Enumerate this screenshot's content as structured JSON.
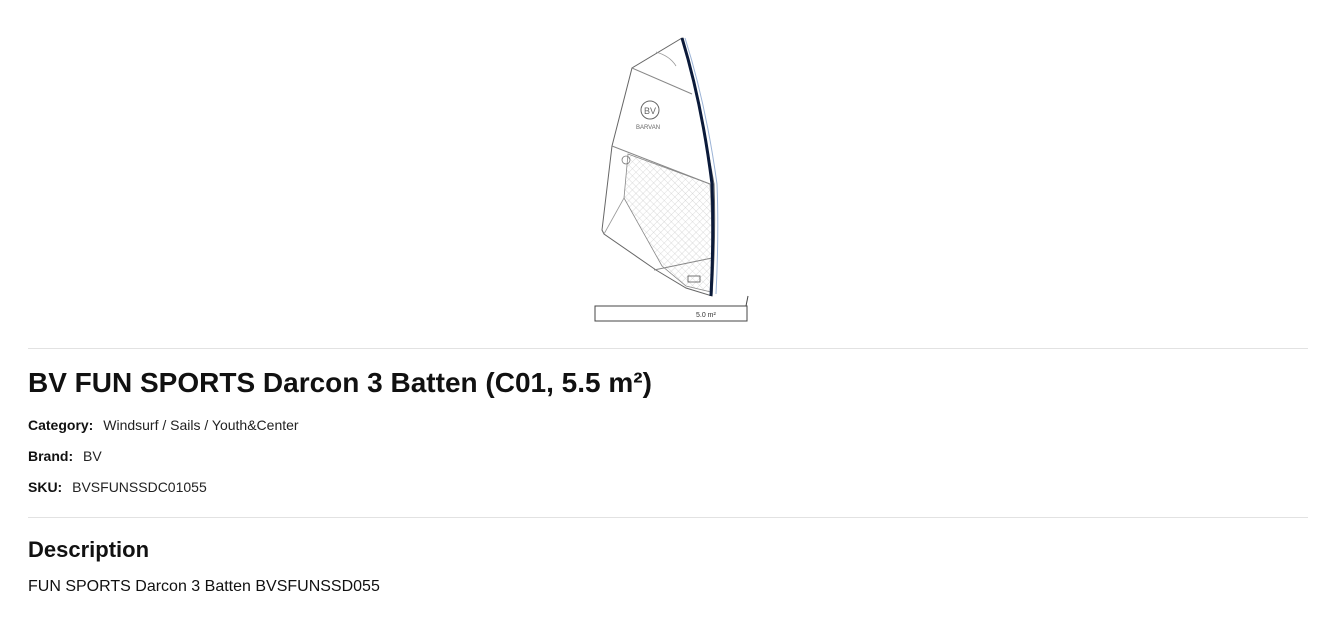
{
  "product": {
    "image_label": "5.0 m²",
    "image_logo_text": "BARVAN",
    "image_logo_mark": "BV",
    "title": "BV FUN SPORTS Darcon 3 Batten (C01, 5.5 m²)",
    "meta": {
      "category_label": "Category:",
      "category_value": "Windsurf / Sails / Youth&Center",
      "brand_label": "Brand:",
      "brand_value": "BV",
      "sku_label": "SKU:",
      "sku_value": "BVSFUNSSDC01055"
    },
    "description": {
      "heading": "Description",
      "text": "FUN SPORTS Darcon 3 Batten BVSFUNSSD055"
    }
  },
  "colors": {
    "mast": "#0b1a3a",
    "outline": "#555555",
    "mesh": "#bbbbbb",
    "divider": "#e2e2e2"
  }
}
